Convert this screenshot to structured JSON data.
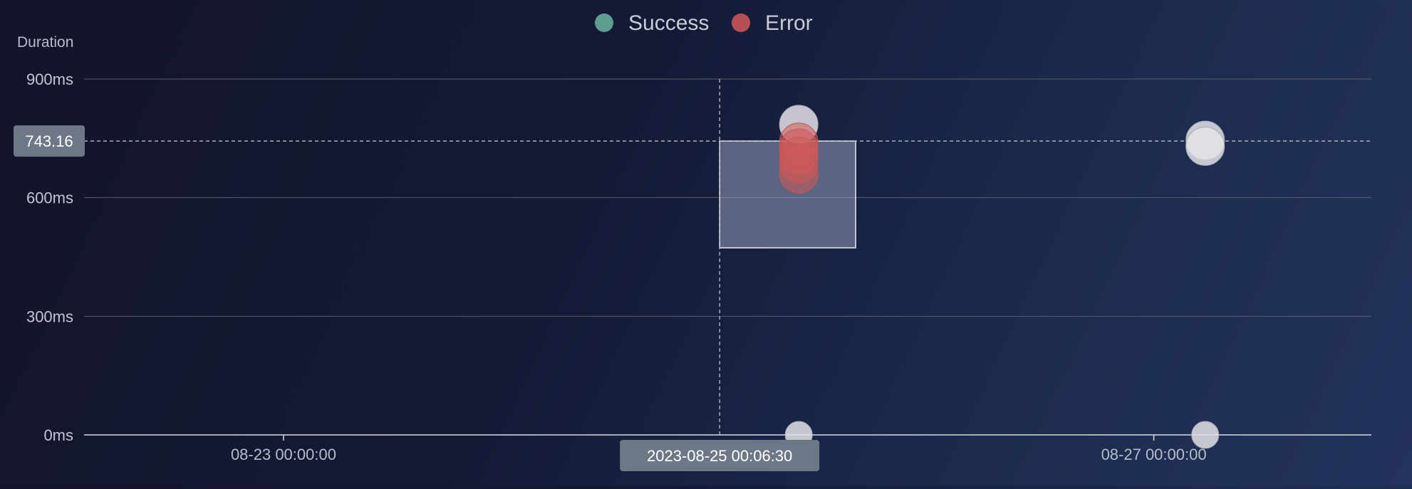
{
  "chart_data": {
    "type": "scatter",
    "ylabel": "Duration",
    "y_unit": "ms",
    "ylim": [
      0,
      900
    ],
    "yticks": [
      0,
      300,
      600,
      900
    ],
    "xlim": [
      "2023-08-22 02:00:00",
      "2023-08-28 00:00:00"
    ],
    "xticks": [
      {
        "value": "2023-08-23 00:00:00",
        "label": "08-23 00:00:00"
      },
      {
        "value": "2023-08-27 00:00:00",
        "label": "08-27 00:00:00"
      }
    ],
    "grid": true,
    "legend": {
      "placement": "top-center",
      "entries": [
        {
          "name": "Success",
          "color": "#5f9e8f"
        },
        {
          "name": "Error",
          "color": "#b94e55"
        }
      ]
    },
    "crosshair": {
      "x": "2023-08-25 00:06:30",
      "x_label": "2023-08-25 00:06:30",
      "y": 743.16,
      "y_label": "743.16"
    },
    "selection_box": {
      "x_range": [
        "2023-08-25 00:06:30",
        "2023-08-25 15:06:30"
      ],
      "y_range": [
        473,
        743.16
      ]
    },
    "series": [
      {
        "name": "Success",
        "color": "#e3e3e7",
        "points": [
          {
            "x": "2023-08-25 08:50:00",
            "y": 785
          },
          {
            "x": "2023-08-25 08:50:00",
            "y": 0
          },
          {
            "x": "2023-08-27 05:40:00",
            "y": 745
          },
          {
            "x": "2023-08-27 05:40:00",
            "y": 730
          },
          {
            "x": "2023-08-27 05:40:00",
            "y": 0
          }
        ]
      },
      {
        "name": "Error",
        "color": "#d05a5a",
        "points": [
          {
            "x": "2023-08-25 08:50:00",
            "y": 660
          },
          {
            "x": "2023-08-25 08:50:00",
            "y": 685
          },
          {
            "x": "2023-08-25 08:50:00",
            "y": 705
          },
          {
            "x": "2023-08-25 08:50:00",
            "y": 725
          },
          {
            "x": "2023-08-25 08:50:00",
            "y": 740
          }
        ]
      }
    ]
  }
}
